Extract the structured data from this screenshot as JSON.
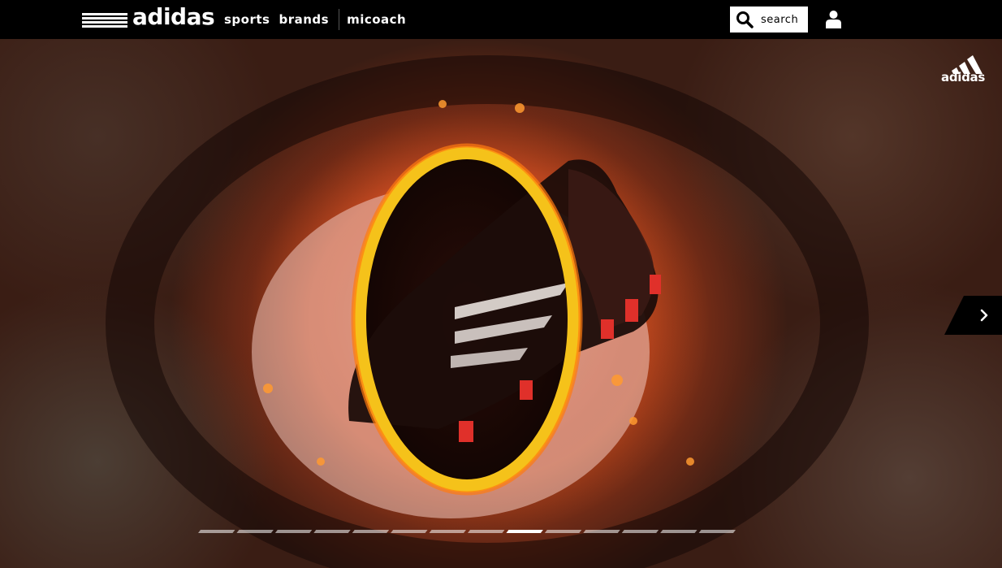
{
  "header": {
    "brand": "adidas",
    "nav": [
      "sports",
      "brands",
      "micoach"
    ],
    "search_label": "search"
  },
  "hero": {
    "corner_logo": "adidas",
    "next_icon": "chevron-right-icon",
    "slides_total": 14,
    "active_slide": 9
  },
  "colors": {
    "topbar": "#000000",
    "ring": "#f5c21a",
    "fire": "#e0501a"
  }
}
